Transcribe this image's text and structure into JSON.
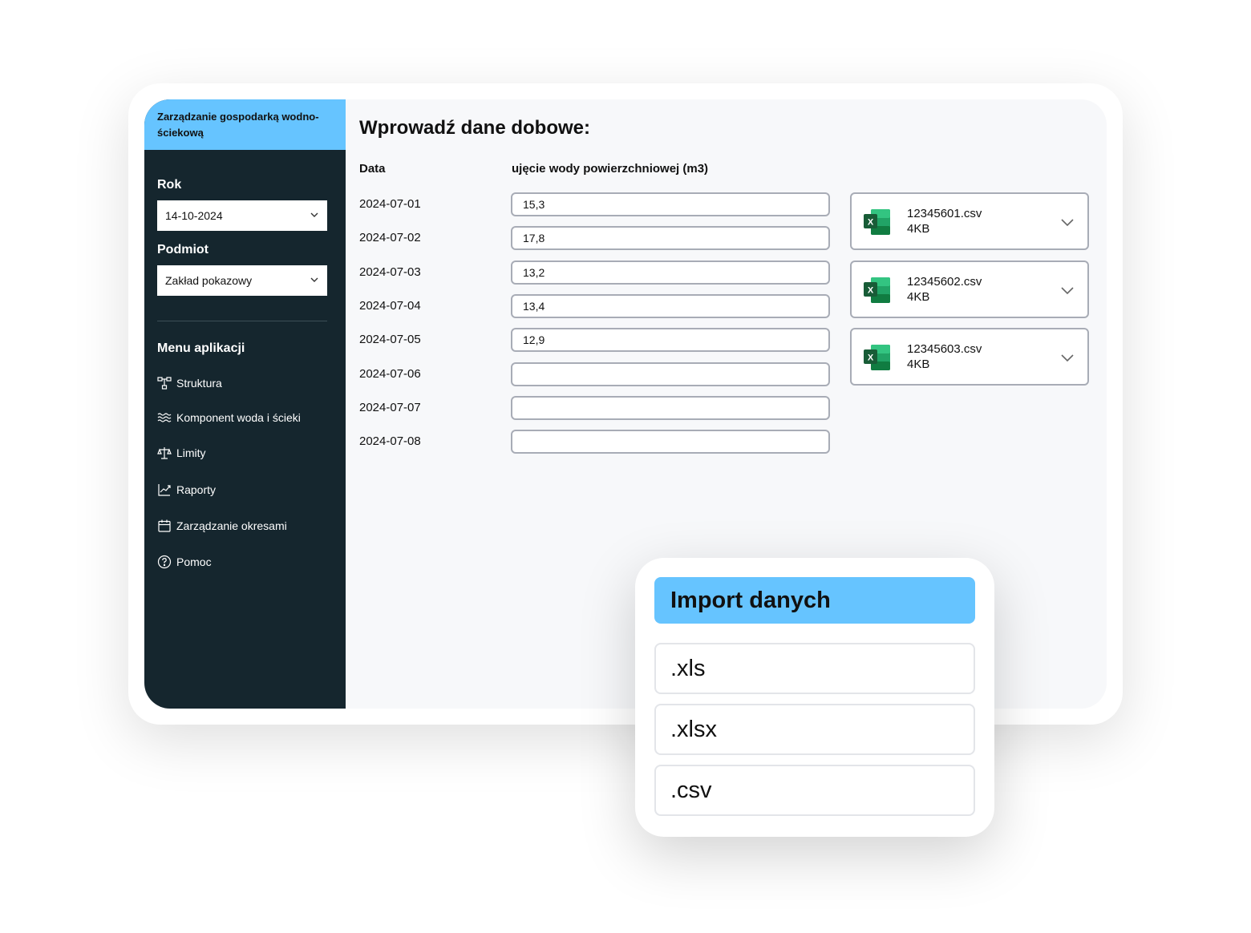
{
  "sidebar": {
    "app_title": "Zarządzanie gospodarką wodno-ściekową",
    "year_label": "Rok",
    "year_value": "14-10-2024",
    "entity_label": "Podmiot",
    "entity_value": "Zakład pokazowy",
    "menu_title": "Menu aplikacji",
    "menu": [
      {
        "label": "Struktura",
        "icon": "structure-icon"
      },
      {
        "label": "Komponent woda i ścieki",
        "icon": "waves-icon"
      },
      {
        "label": "Limity",
        "icon": "scales-icon"
      },
      {
        "label": "Raporty",
        "icon": "chart-line-icon"
      },
      {
        "label": "Zarządzanie okresami",
        "icon": "calendar-icon"
      },
      {
        "label": "Pomoc",
        "icon": "help-circle-icon"
      }
    ]
  },
  "main": {
    "title": "Wprowadź dane dobowe:",
    "col_date": "Data",
    "col_value": "ujęcie wody powierzchniowej (m3)",
    "rows": [
      {
        "date": "2024-07-01",
        "value": "15,3"
      },
      {
        "date": "2024-07-02",
        "value": "17,8"
      },
      {
        "date": "2024-07-03",
        "value": "13,2"
      },
      {
        "date": "2024-07-04",
        "value": "13,4"
      },
      {
        "date": "2024-07-05",
        "value": "12,9"
      },
      {
        "date": "2024-07-06",
        "value": ""
      },
      {
        "date": "2024-07-07",
        "value": ""
      },
      {
        "date": "2024-07-08",
        "value": ""
      }
    ],
    "files": [
      {
        "name": "12345601.csv",
        "size": "4KB"
      },
      {
        "name": "12345602.csv",
        "size": "4KB"
      },
      {
        "name": "12345603.csv",
        "size": "4KB"
      }
    ]
  },
  "import": {
    "title": "Import danych",
    "options": [
      ".xls",
      ".xlsx",
      ".csv"
    ]
  },
  "colors": {
    "accent": "#66c4ff",
    "sidebar_bg": "#15262e",
    "excel_green": "#1d7a44"
  }
}
